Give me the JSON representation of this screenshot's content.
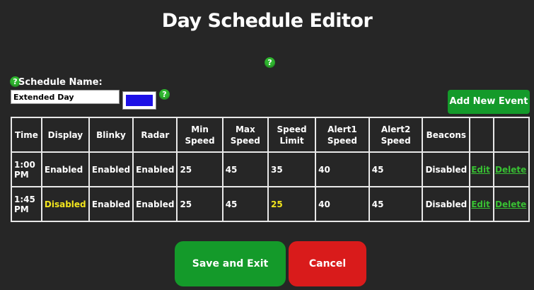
{
  "page": {
    "title": "Day Schedule Editor"
  },
  "help_icon_glyph": "?",
  "schedule": {
    "label": "Schedule Name:",
    "name_value": "Extended Day",
    "color": "#1d10e6"
  },
  "add_button_label": "Add New Event",
  "table": {
    "headers": [
      "Time",
      "Display",
      "Blinky",
      "Radar",
      "Min Speed",
      "Max Speed",
      "Speed Limit",
      "Alert1 Speed",
      "Alert2 Speed",
      "Beacons",
      "",
      ""
    ],
    "rows": [
      [
        "1:00 PM",
        "Enabled",
        "Enabled",
        "Enabled",
        "25",
        "45",
        "35",
        "40",
        "45",
        "Disabled",
        "Edit",
        "Delete"
      ],
      [
        "1:45 PM",
        "Disabled",
        "Enabled",
        "Enabled",
        "25",
        "45",
        "25",
        "40",
        "45",
        "Disabled",
        "Edit",
        "Delete"
      ]
    ]
  },
  "buttons": {
    "save": "Save and Exit",
    "cancel": "Cancel"
  },
  "colors": {
    "accent_green": "#149a2a",
    "danger_red": "#d91b1b",
    "highlight_yellow": "#f2e51d",
    "link_green": "#38c033"
  }
}
